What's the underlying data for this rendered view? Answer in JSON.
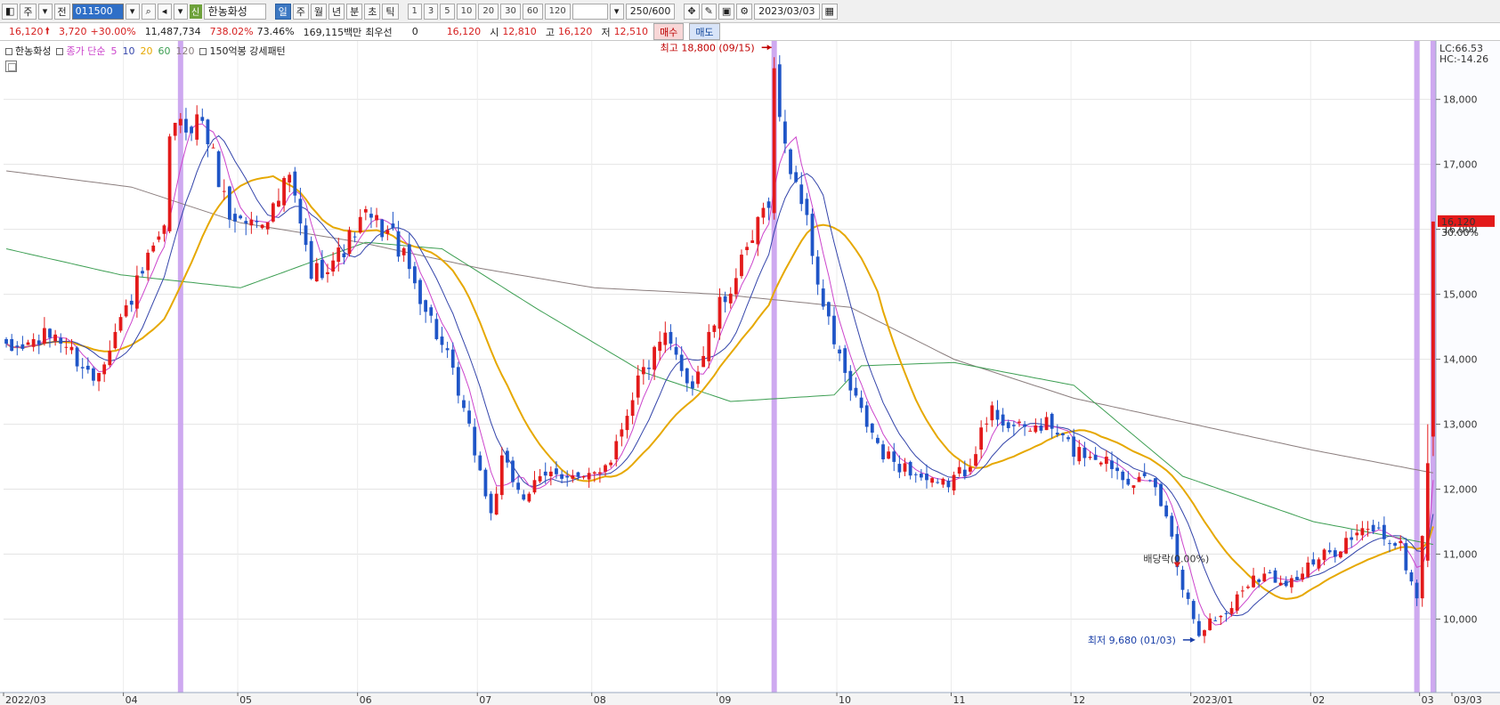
{
  "toolbar": {
    "market_label": "주",
    "period_label": "전",
    "stock_code": "011500",
    "new_badge": "신",
    "stock_name": "한농화성",
    "period_buttons": [
      "일",
      "주",
      "월",
      "년",
      "분",
      "초",
      "틱"
    ],
    "interval_buttons": [
      "1",
      "3",
      "5",
      "10",
      "20",
      "30",
      "60",
      "120"
    ],
    "count_display": "250/600",
    "date": "2023/03/03"
  },
  "quote": {
    "price": "16,120",
    "change": "3,720",
    "change_pct": "+30.00%",
    "volume": "11,487,734",
    "volume_ratio": "738.02%",
    "turnover": "73.46%",
    "amount": "169,115백만",
    "priority_label": "최우선",
    "priority_value": "0",
    "ask_price": "16,120",
    "open_label": "시",
    "open": "12,810",
    "high_label": "고",
    "high": "16,120",
    "low_label": "저",
    "low": "12,510",
    "buy_label": "매수",
    "sell_label": "매도"
  },
  "legend": {
    "name": "한농화성",
    "ma_type": "종가 단순",
    "periods": [
      "5",
      "10",
      "20",
      "60",
      "120"
    ],
    "pattern": "150억봉 강세패턴"
  },
  "right_panel": {
    "lc": "LC:66.53",
    "hc": "HC:-14.26",
    "price_tag": "16,120",
    "pct_tag": "30.00%"
  },
  "chart_data": {
    "type": "candlestick",
    "title": "",
    "y_range": [
      9500,
      18900
    ],
    "y_ticks": [
      "10,000",
      "11,000",
      "12,000",
      "13,000",
      "14,000",
      "15,000",
      "16,000",
      "17,000",
      "18,000"
    ],
    "x_labels": [
      "2022/03",
      "04",
      "05",
      "06",
      "07",
      "08",
      "09",
      "10",
      "11",
      "12",
      "2023/01",
      "02",
      "03",
      "03/03"
    ],
    "colors": {
      "up": "#e31a1a",
      "down": "#1f55c7",
      "ma5": "#cc44cc",
      "ma10": "#3344aa",
      "ma20": "#e6a800",
      "ma60": "#3c9e52",
      "ma120": "#8b7e7e",
      "highlight": "#c9a0ee"
    },
    "annotations": {
      "high": "최고 18,800 (09/15)",
      "low": "최저 9,680 (01/03)",
      "dividend": "배당락(0.00%)"
    },
    "anchors": [
      [
        "2022/03/02",
        14100
      ],
      [
        "2022/03/15",
        14400
      ],
      [
        "2022/03/24",
        13700
      ],
      [
        "2022/03/31",
        14600
      ],
      [
        "2022/04/07",
        15500
      ],
      [
        "2022/04/12",
        15900
      ],
      [
        "2022/04/13",
        17500
      ],
      [
        "2022/04/21",
        17700
      ],
      [
        "2022/04/28",
        16200
      ],
      [
        "2022/05/04",
        16100
      ],
      [
        "2022/05/10",
        16300
      ],
      [
        "2022/05/13",
        16800
      ],
      [
        "2022/05/19",
        15300
      ],
      [
        "2022/05/26",
        15600
      ],
      [
        "2022/06/02",
        16200
      ],
      [
        "2022/06/09",
        15900
      ],
      [
        "2022/06/16",
        15000
      ],
      [
        "2022/06/23",
        14000
      ],
      [
        "2022/06/30",
        12600
      ],
      [
        "2022/07/05",
        11600
      ],
      [
        "2022/07/07",
        12400
      ],
      [
        "2022/07/13",
        11900
      ],
      [
        "2022/07/21",
        12300
      ],
      [
        "2022/07/28",
        12100
      ],
      [
        "2022/08/04",
        12500
      ],
      [
        "2022/08/11",
        13700
      ],
      [
        "2022/08/18",
        14300
      ],
      [
        "2022/08/25",
        13600
      ],
      [
        "2022/09/01",
        14800
      ],
      [
        "2022/09/08",
        15600
      ],
      [
        "2022/09/14",
        16500
      ],
      [
        "2022/09/15",
        18400
      ],
      [
        "2022/09/19",
        17200
      ],
      [
        "2022/09/22",
        16500
      ],
      [
        "2022/09/28",
        14800
      ],
      [
        "2022/10/05",
        13500
      ],
      [
        "2022/10/13",
        12500
      ],
      [
        "2022/10/20",
        12300
      ],
      [
        "2022/10/27",
        12000
      ],
      [
        "2022/11/03",
        12300
      ],
      [
        "2022/11/10",
        13200
      ],
      [
        "2022/11/17",
        12900
      ],
      [
        "2022/11/24",
        13000
      ],
      [
        "2022/12/01",
        12600
      ],
      [
        "2022/12/08",
        12500
      ],
      [
        "2022/12/15",
        12200
      ],
      [
        "2022/12/22",
        12000
      ],
      [
        "2022/12/27",
        11300
      ],
      [
        "2022/12/29",
        10500
      ],
      [
        "2023/01/03",
        9850
      ],
      [
        "2023/01/10",
        10100
      ],
      [
        "2023/01/17",
        10700
      ],
      [
        "2023/01/26",
        10600
      ],
      [
        "2023/02/02",
        10900
      ],
      [
        "2023/02/09",
        11200
      ],
      [
        "2023/02/16",
        11400
      ],
      [
        "2023/02/23",
        11100
      ],
      [
        "2023/02/28",
        10300
      ],
      [
        "2023/03/02",
        12400
      ],
      [
        "2023/03/03",
        16120
      ]
    ],
    "ma_levels": {
      "ma60": [
        [
          "2022/03/02",
          15700
        ],
        [
          "2022/03/31",
          15300
        ],
        [
          "2022/05/02",
          15100
        ],
        [
          "2022/06/02",
          15800
        ],
        [
          "2022/06/22",
          15700
        ],
        [
          "2022/07/15",
          14800
        ],
        [
          "2022/08/12",
          13800
        ],
        [
          "2022/09/05",
          13350
        ],
        [
          "2022/09/30",
          13450
        ],
        [
          "2022/10/07",
          13900
        ],
        [
          "2022/11/01",
          13950
        ],
        [
          "2022/12/01",
          13600
        ],
        [
          "2022/12/29",
          12200
        ],
        [
          "2023/02/01",
          11500
        ],
        [
          "2023/03/03",
          11150
        ]
      ],
      "ma120": [
        [
          "2022/03/02",
          16900
        ],
        [
          "2022/04/04",
          16650
        ],
        [
          "2022/05/02",
          16100
        ],
        [
          "2022/06/01",
          15800
        ],
        [
          "2022/07/01",
          15400
        ],
        [
          "2022/08/01",
          15100
        ],
        [
          "2022/09/01",
          15000
        ],
        [
          "2022/10/05",
          14800
        ],
        [
          "2022/11/01",
          14000
        ],
        [
          "2022/12/01",
          13400
        ],
        [
          "2023/01/02",
          13000
        ],
        [
          "2023/02/01",
          12600
        ],
        [
          "2023/03/03",
          12250
        ]
      ]
    },
    "highlight_dates": [
      "2022/04/15",
      "2022/09/15",
      "2023/02/28",
      "2023/03/03"
    ]
  }
}
